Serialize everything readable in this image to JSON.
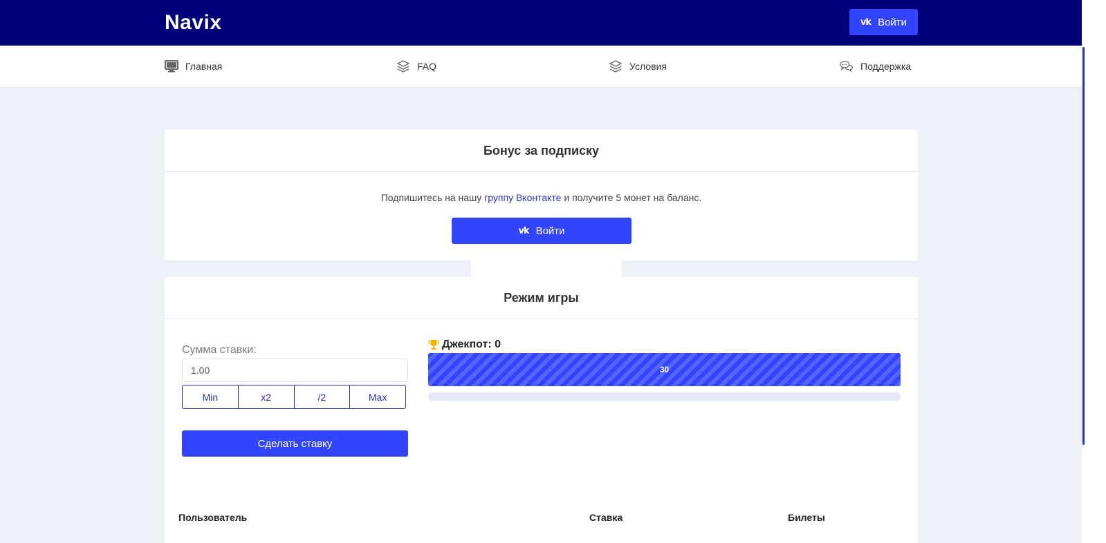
{
  "header": {
    "logo": "Navix",
    "login_label": "Войти",
    "vk_glyph": "vk"
  },
  "nav": {
    "items": [
      {
        "label": "Главная",
        "icon": "monitor-icon"
      },
      {
        "label": "FAQ",
        "icon": "layers-icon"
      },
      {
        "label": "Условия",
        "icon": "layers-icon"
      },
      {
        "label": "Поддержка",
        "icon": "chat-icon"
      }
    ]
  },
  "bonus": {
    "title": "Бонус за подписку",
    "text_before": "Подпишитесь на нашу ",
    "link_text": "группу Вконтакте",
    "text_after": " и получите 5 монет на баланс.",
    "login_label": "Войти"
  },
  "game": {
    "title": "Режим игры",
    "bet_label": "Сумма ставки:",
    "bet_value": "1.00",
    "ops": [
      "Min",
      "x2",
      "/2",
      "Max"
    ],
    "place_bet_label": "Сделать ставку",
    "jackpot_label": "Джекпот: 0",
    "timer_value": "30",
    "progress_fill_fraction": 0
  },
  "table": {
    "columns": [
      "Пользователь",
      "Ставка",
      "Билеты"
    ]
  },
  "colors": {
    "header_bg": "#00007b",
    "accent": "#3344ff",
    "page_bg": "#eef1f8"
  }
}
